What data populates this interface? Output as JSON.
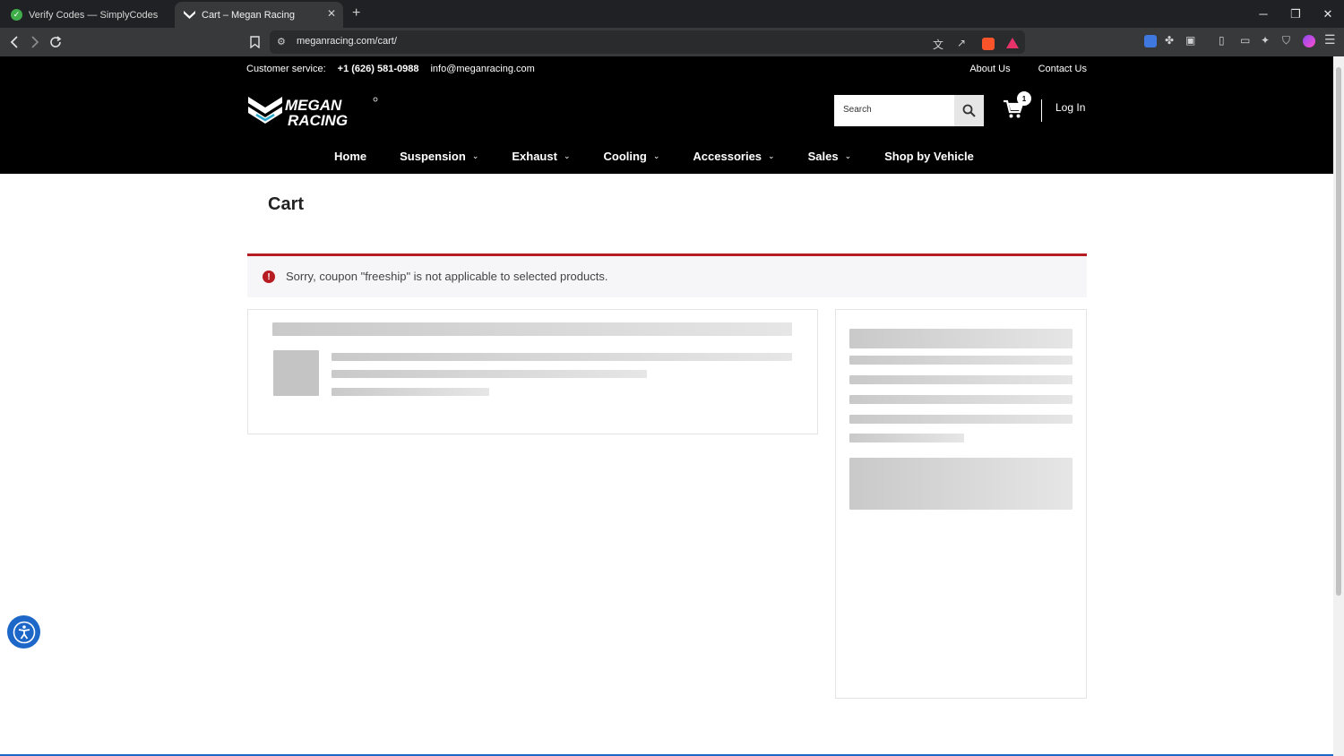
{
  "browser": {
    "tabs": [
      {
        "title": "Verify Codes — SimplyCodes",
        "favicon": "simplycodes-check-icon"
      },
      {
        "title": "Cart – Megan Racing",
        "favicon": "megan-racing-icon"
      }
    ],
    "url": "meganracing.com/cart/"
  },
  "site": {
    "topbar": {
      "label": "Customer service:",
      "phone": "+1 (626) 581-0988",
      "email": "info@meganracing.com",
      "links": [
        "About Us",
        "Contact Us"
      ]
    },
    "logo_text": [
      "MEGAN",
      "RACING"
    ],
    "search_placeholder": "Search",
    "cart_count": "1",
    "login": "Log In",
    "nav": [
      {
        "label": "Home",
        "dropdown": false
      },
      {
        "label": "Suspension",
        "dropdown": true
      },
      {
        "label": "Exhaust",
        "dropdown": true
      },
      {
        "label": "Cooling",
        "dropdown": true
      },
      {
        "label": "Accessories",
        "dropdown": true
      },
      {
        "label": "Sales",
        "dropdown": true
      },
      {
        "label": "Shop by Vehicle",
        "dropdown": false
      }
    ]
  },
  "cart": {
    "title": "Cart",
    "notice": "Sorry, coupon \"freeship\" is not applicable to selected products.",
    "notice_color": "#b81c23"
  }
}
